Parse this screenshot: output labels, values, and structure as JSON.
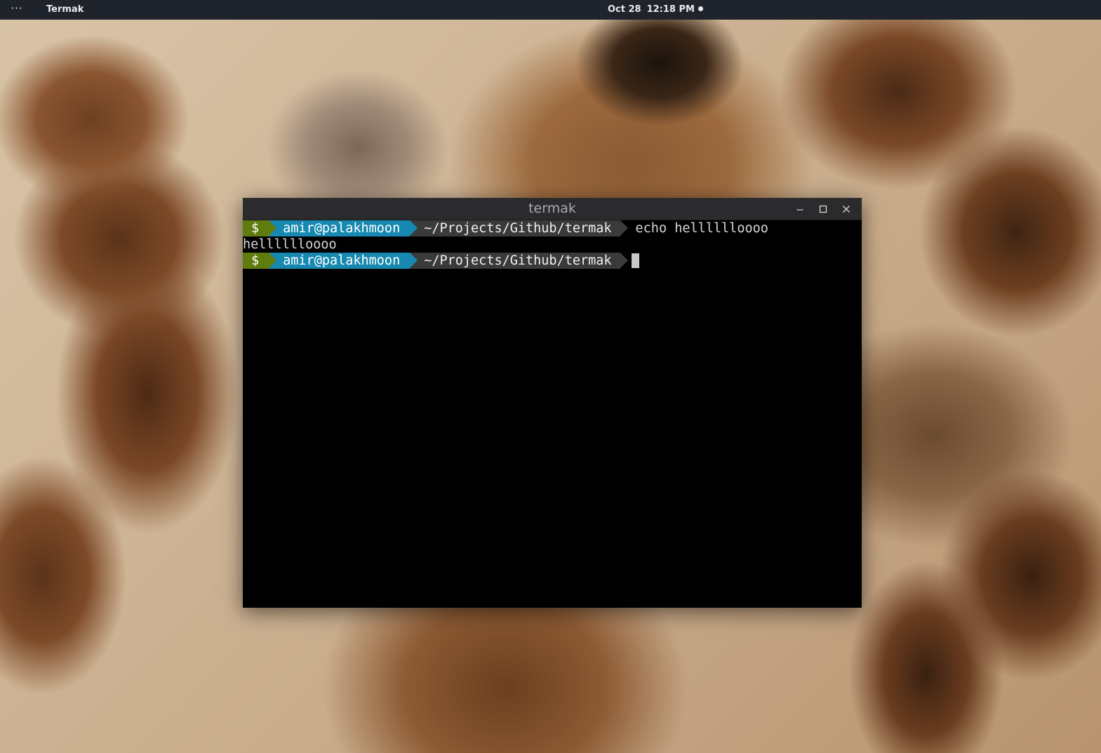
{
  "topbar": {
    "activities_label": "···",
    "app_name": "Termak",
    "date": "Oct 28",
    "time": "12:18 PM"
  },
  "window": {
    "title": "termak",
    "controls": {
      "minimize_icon": "minimize-icon",
      "maximize_icon": "maximize-icon",
      "close_icon": "close-icon"
    }
  },
  "terminal": {
    "lines": [
      {
        "type": "prompt",
        "symbol": "$",
        "user_host": "amir@palakhmoon",
        "path": "~/Projects/Github/termak",
        "command": "echo helllllloooo"
      },
      {
        "type": "output",
        "text": "helllllloooo"
      },
      {
        "type": "prompt",
        "symbol": "$",
        "user_host": "amir@palakhmoon",
        "path": "~/Projects/Github/termak",
        "command": ""
      }
    ],
    "colors": {
      "background": "#000000",
      "symbol_segment": "#5f7d0e",
      "user_segment": "#1789b0",
      "path_segment": "#3a3a3a",
      "text": "#d6d6d6"
    }
  },
  "wallpaper": "giraffe-photo"
}
